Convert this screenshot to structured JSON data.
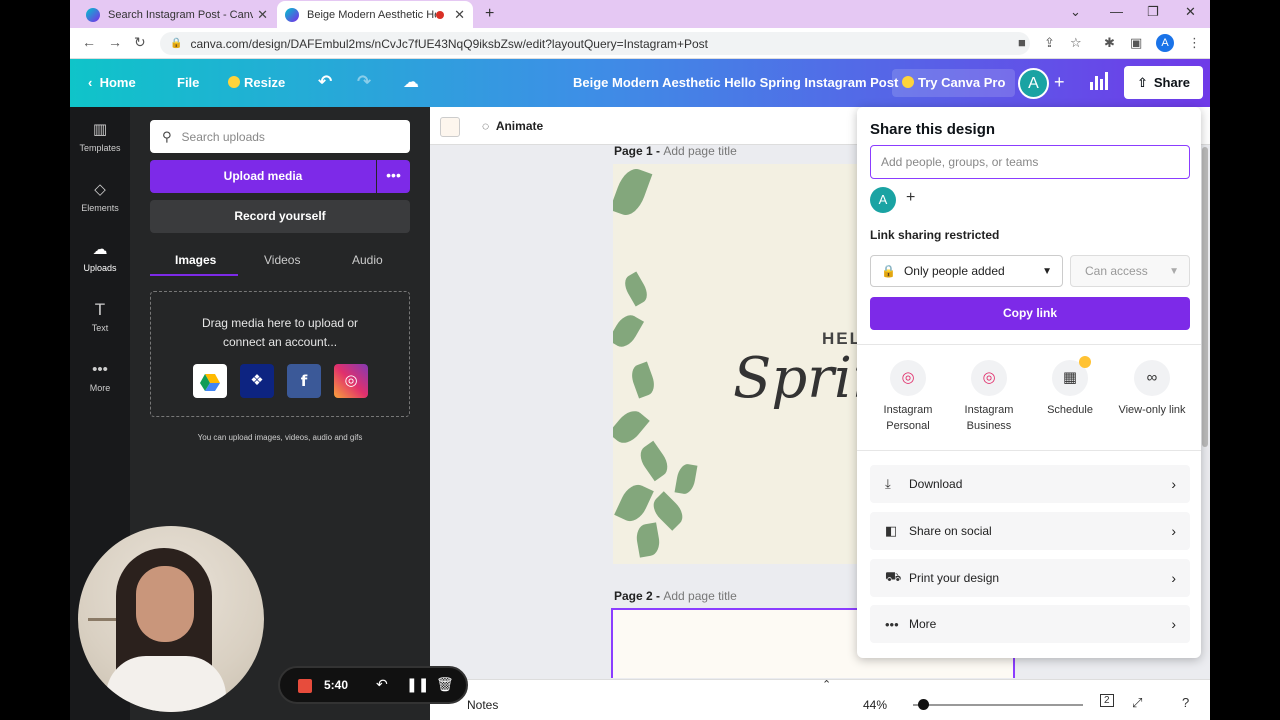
{
  "browser": {
    "tabs": [
      {
        "title": "Search Instagram Post - Canva"
      },
      {
        "title": "Beige Modern Aesthetic Hell"
      }
    ],
    "url": "canva.com/design/DAFEmbul2ms/nCvJc7fUE43NqQ9iksbZsw/edit?layoutQuery=Instagram+Post",
    "profile_initial": "A"
  },
  "header": {
    "home": "Home",
    "file": "File",
    "resize": "Resize",
    "design_title": "Beige Modern Aesthetic Hello Spring Instagram Post",
    "try_pro": "Try Canva Pro",
    "avatar_initial": "A",
    "share": "Share"
  },
  "rail": {
    "items": [
      {
        "label": "Templates"
      },
      {
        "label": "Elements"
      },
      {
        "label": "Uploads"
      },
      {
        "label": "Text"
      },
      {
        "label": "More"
      }
    ]
  },
  "uploads_panel": {
    "search_placeholder": "Search uploads",
    "upload_media": "Upload media",
    "record_yourself": "Record yourself",
    "tabs": [
      "Images",
      "Videos",
      "Audio"
    ],
    "dropzone_line1": "Drag media here to upload or",
    "dropzone_line2": "connect an account...",
    "note": "You can upload images, videos, audio and gifs"
  },
  "recorder": {
    "time": "5:40"
  },
  "canvas": {
    "animate": "Animate",
    "page1_label": "Page 1 -",
    "page2_label": "Page 2 -",
    "add_page_title": "Add page title",
    "design_text_hello": "HEL",
    "design_text_spring": "Sprir",
    "notes": "Notes",
    "zoom": "44%",
    "page_count": "2"
  },
  "share_panel": {
    "title": "Share this design",
    "input_placeholder": "Add people, groups, or teams",
    "avatar_initial": "A",
    "restriction": "Link sharing restricted",
    "access_scope": "Only people added",
    "access_level": "Can access",
    "copy_link": "Copy link",
    "options": [
      {
        "line1": "Instagram",
        "line2": "Personal"
      },
      {
        "line1": "Instagram",
        "line2": "Business"
      },
      {
        "line1": "Schedule",
        "line2": ""
      },
      {
        "line1": "View-only link",
        "line2": ""
      }
    ],
    "actions": [
      {
        "label": "Download"
      },
      {
        "label": "Share on social"
      },
      {
        "label": "Print your design"
      },
      {
        "label": "More"
      }
    ]
  },
  "colors": {
    "accent_purple": "#7d2ae8",
    "header_start": "#0fc4c9",
    "header_end": "#6f3ae8",
    "panel_dark": "#252627"
  }
}
